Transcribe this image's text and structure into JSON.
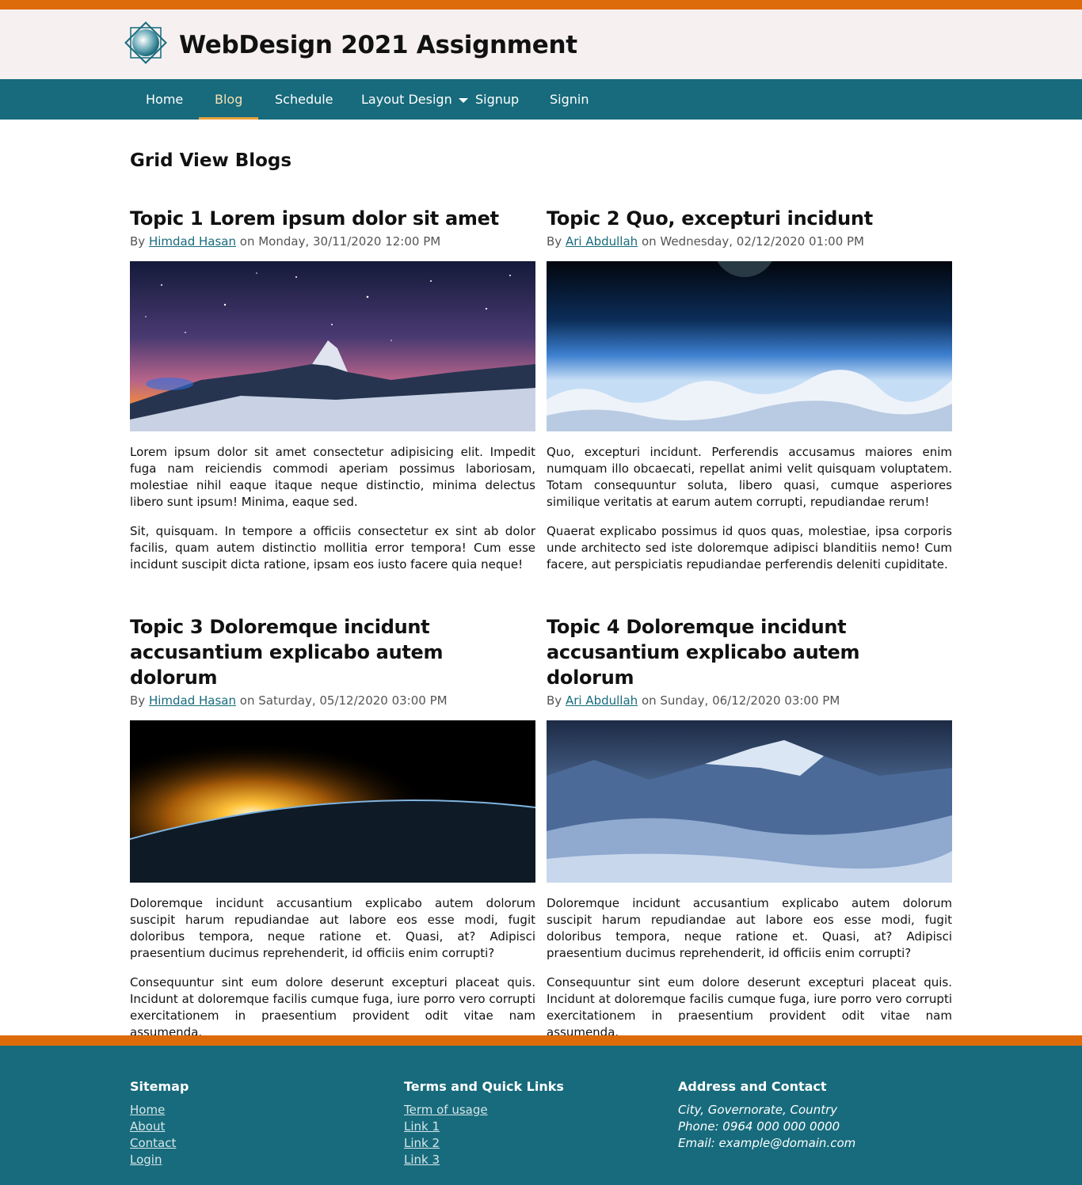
{
  "colors": {
    "accent": "#dd6b0a",
    "primary": "#176b7c",
    "brand_bg": "#f6f0f0",
    "active_underline": "#e8a23c"
  },
  "header": {
    "title": "WebDesign 2021 Assignment",
    "logo_icon": "diamond-globe-icon"
  },
  "nav": {
    "items": [
      {
        "label": "Home"
      },
      {
        "label": "Blog",
        "active": true
      },
      {
        "label": "Schedule"
      },
      {
        "label": "Layout Design",
        "has_dropdown": true
      },
      {
        "label": "Signup"
      },
      {
        "label": "Signin"
      }
    ]
  },
  "main": {
    "heading": "Grid View Blogs",
    "posts": [
      {
        "title": "Topic 1 Lorem ipsum dolor sit amet",
        "by": "By",
        "author": "Himdad Hasan",
        "on": "on Monday, 30/11/2020 12:00 PM",
        "image": "starry-mountain-sunset",
        "paragraphs": [
          "Lorem ipsum dolor sit amet consectetur adipisicing elit. Impedit fuga nam reiciendis commodi aperiam possimus laboriosam, molestiae nihil eaque itaque neque distinctio, minima delectus libero sunt ipsum! Minima, eaque sed.",
          "Sit, quisquam. In tempore a officiis consectetur ex sint ab dolor facilis, quam autem distinctio mollitia error tempora! Cum esse incidunt suscipit dicta ratione, ipsam eos iusto facere quia neque!"
        ]
      },
      {
        "title": "Topic 2 Quo, excepturi incidunt",
        "by": "By",
        "author": "Ari Abdullah",
        "on": "on Wednesday, 02/12/2020 01:00 PM",
        "image": "earth-clouds-from-space",
        "paragraphs": [
          "Quo, excepturi incidunt. Perferendis accusamus maiores enim numquam illo obcaecati, repellat animi velit quisquam voluptatem. Totam consequuntur soluta, libero quasi, cumque asperiores similique veritatis at earum autem corrupti, repudiandae rerum!",
          "Quaerat explicabo possimus id quos quas, molestiae, ipsa corporis unde architecto sed iste doloremque adipisci blanditiis nemo! Cum facere, aut perspiciatis repudiandae perferendis deleniti cupiditate."
        ]
      },
      {
        "title": "Topic 3 Doloremque incidunt accusantium explicabo autem dolorum",
        "by": "By",
        "author": "Himdad Hasan",
        "on": "on Saturday, 05/12/2020 03:00 PM",
        "image": "sunrise-over-planet",
        "paragraphs": [
          "Doloremque incidunt accusantium explicabo autem dolorum suscipit harum repudiandae aut labore eos esse modi, fugit doloribus tempora, neque ratione et. Quasi, at? Adipisci praesentium ducimus reprehenderit, id officiis enim corrupti?",
          "Consequuntur sint eum dolore deserunt excepturi placeat quis. Incidunt at doloremque facilis cumque fuga, iure porro vero corrupti exercitationem in praesentium provident odit vitae nam assumenda."
        ]
      },
      {
        "title": "Topic 4 Doloremque incidunt accusantium explicabo autem dolorum",
        "by": "By",
        "author": "Ari Abdullah",
        "on": "on Sunday, 06/12/2020 03:00 PM",
        "image": "icy-blue-mountains",
        "paragraphs": [
          "Doloremque incidunt accusantium explicabo autem dolorum suscipit harum repudiandae aut labore eos esse modi, fugit doloribus tempora, neque ratione et. Quasi, at? Adipisci praesentium ducimus reprehenderit, id officiis enim corrupti?",
          "Consequuntur sint eum dolore deserunt excepturi placeat quis. Incidunt at doloremque facilis cumque fuga, iure porro vero corrupti exercitationem in praesentium provident odit vitae nam assumenda."
        ]
      }
    ]
  },
  "footer": {
    "sitemap": {
      "heading": "Sitemap",
      "links": [
        "Home",
        "About",
        "Contact",
        "Login"
      ]
    },
    "terms": {
      "heading": "Terms and Quick Links",
      "links": [
        "Term of usage",
        "Link 1",
        "Link 2",
        "Link 3"
      ]
    },
    "contact": {
      "heading": "Address and Contact",
      "lines": [
        "City, Governorate, Country",
        "Phone: 0964 000 000 0000",
        "Email: example@domain.com"
      ]
    }
  }
}
